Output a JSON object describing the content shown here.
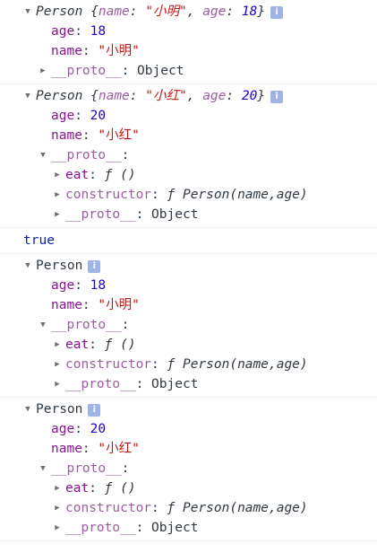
{
  "info_glyph": "i",
  "expanded_glyph": "▼",
  "collapsed_glyph": "▶",
  "m1": {
    "summary": {
      "cls": "Person",
      "open": "{",
      "k1": "name",
      "sep1": ": ",
      "v1": "\"小明\"",
      "comma": ", ",
      "k2": "age",
      "sep2": ": ",
      "v2": "18",
      "close": "}"
    },
    "age_key": "age",
    "age_val": "18",
    "name_key": "name",
    "name_val": "\"小明\"",
    "proto_key": "__proto__",
    "proto_val": "Object"
  },
  "m2": {
    "summary": {
      "cls": "Person",
      "open": "{",
      "k1": "name",
      "sep1": ": ",
      "v1": "\"小红\"",
      "comma": ", ",
      "k2": "age",
      "sep2": ": ",
      "v2": "20",
      "close": "}"
    },
    "age_key": "age",
    "age_val": "20",
    "name_key": "name",
    "name_val": "\"小红\"",
    "proto_key": "__proto__",
    "eat_key": "eat",
    "eat_val": "ƒ ()",
    "ctor_key": "constructor",
    "ctor_val": "ƒ Person(name,age)",
    "proto2_key": "__proto__",
    "proto2_val": "Object"
  },
  "m3": {
    "bool": "true"
  },
  "m4": {
    "title": "Person",
    "age_key": "age",
    "age_val": "18",
    "name_key": "name",
    "name_val": "\"小明\"",
    "proto_key": "__proto__",
    "eat_key": "eat",
    "eat_val": "ƒ ()",
    "ctor_key": "constructor",
    "ctor_val": "ƒ Person(name,age)",
    "proto2_key": "__proto__",
    "proto2_val": "Object"
  },
  "m5": {
    "title": "Person",
    "age_key": "age",
    "age_val": "20",
    "name_key": "name",
    "name_val": "\"小红\"",
    "proto_key": "__proto__",
    "eat_key": "eat",
    "eat_val": "ƒ ()",
    "ctor_key": "constructor",
    "ctor_val": "ƒ Person(name,age)",
    "proto2_key": "__proto__",
    "proto2_val": "Object"
  }
}
